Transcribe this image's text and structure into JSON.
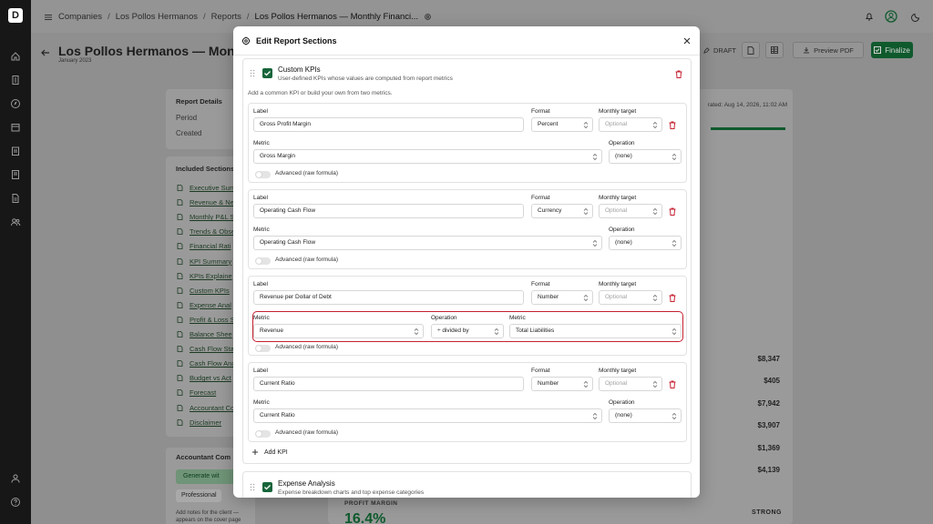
{
  "breadcrumb": {
    "items": [
      "Companies",
      "Los Pollos Hermanos",
      "Reports",
      "Los Pollos Hermanos — Monthly Financi..."
    ]
  },
  "page": {
    "title": "Los Pollos Hermanos — Month",
    "subtitle": "January 2023",
    "generated": "rated: Aug 14, 2026, 11:02 AM",
    "toolbar": {
      "draft": "DRAFT",
      "preview": "Preview PDF",
      "finalize": "Finalize"
    }
  },
  "report_details": {
    "heading": "Report Details",
    "period": "Period",
    "created": "Created"
  },
  "included": {
    "heading": "Included Sections",
    "items": [
      "Executive Sum",
      "Revenue & Ne",
      "Monthly P&L S",
      "Trends & Obse",
      "Financial Rati",
      "KPI Summary",
      "KPIs Explaine",
      "Custom KPIs",
      "Expense Anal",
      "Profit & Loss S",
      "Balance Shee",
      "Cash Flow Sta",
      "Cash Flow Ana",
      "Budget vs Act",
      "Forecast",
      "Accountant Co",
      "Disclaimer"
    ]
  },
  "accountant": {
    "heading": "Accountant Com",
    "generate": "Generate wit",
    "tab": "Professional",
    "note": "Add notes for the client — appears on the cover page"
  },
  "amounts": [
    "$8,347",
    "$405",
    "$7,942",
    "$3,907",
    "$1,369",
    "$4,139"
  ],
  "profit": {
    "label": "PROFIT MARGIN",
    "value": "16.4%",
    "badge": "STRONG"
  },
  "modal": {
    "title": "Edit Report Sections",
    "custom": {
      "title": "Custom KPIs",
      "desc": "User-defined KPIs whose values are computed from report metrics",
      "hint": "Add a common KPI or build your own from two metrics.",
      "labels": {
        "label": "Label",
        "format": "Format",
        "target": "Monthly target",
        "metric": "Metric",
        "operation": "Operation",
        "advanced": "Advanced (raw formula)",
        "target_placeholder": "Optional"
      },
      "kpis": [
        {
          "label": "Gross Profit Margin",
          "format": "Percent",
          "metric": "Gross Margin",
          "operation": "(none)"
        },
        {
          "label": "Operating Cash Flow",
          "format": "Currency",
          "metric": "Operating Cash Flow",
          "operation": "(none)"
        },
        {
          "label": "Revenue per Dollar of Debt",
          "format": "Number",
          "metric": "Revenue",
          "operation": "÷ divided by",
          "metric2": "Total Liabilities"
        },
        {
          "label": "Current Ratio",
          "format": "Number",
          "metric": "Current Ratio",
          "operation": "(none)"
        }
      ],
      "add": "Add KPI"
    },
    "expense": {
      "title": "Expense Analysis",
      "desc": "Expense breakdown charts and top expense categories"
    }
  }
}
